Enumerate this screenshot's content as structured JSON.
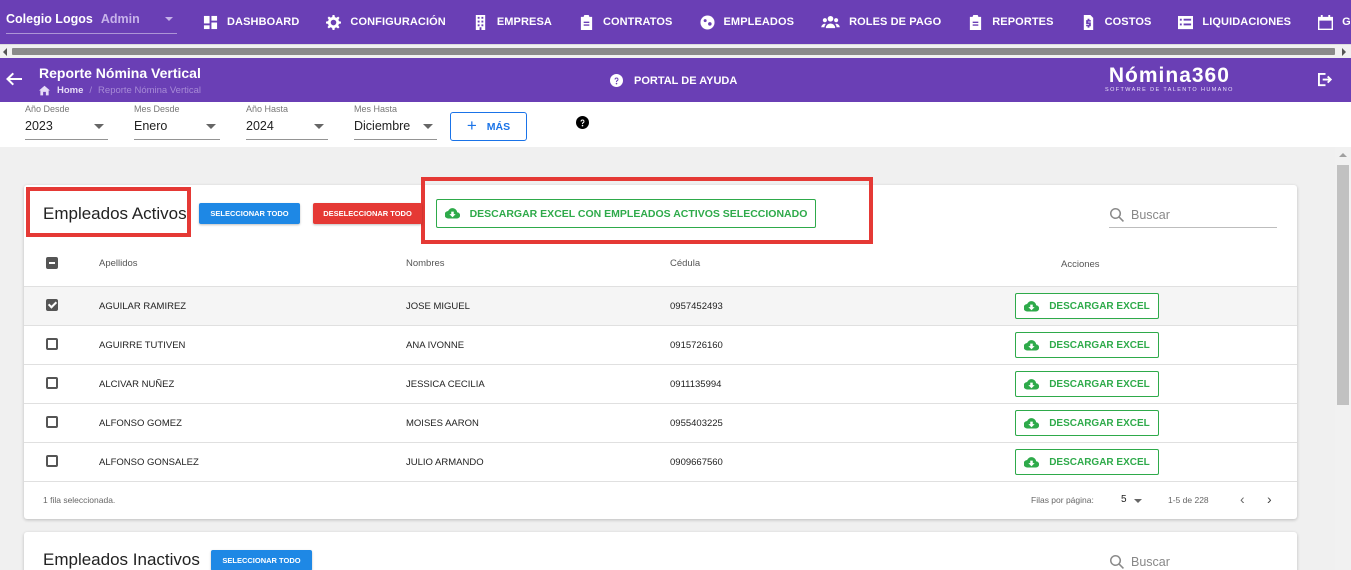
{
  "colors": {
    "nav_purple": "#6a3fb5",
    "primary_blue": "#1e88e5",
    "danger_red": "#e53935",
    "success_green": "#2eaa4a",
    "highlight_red": "#e53935"
  },
  "company": {
    "name": "Colegio Logos",
    "role": "Admin"
  },
  "nav": [
    {
      "label": "DASHBOARD",
      "icon": "dashboard-icon"
    },
    {
      "label": "CONFIGURACIÓN",
      "icon": "gear-icon"
    },
    {
      "label": "EMPRESA",
      "icon": "building-icon"
    },
    {
      "label": "CONTRATOS",
      "icon": "clipboard-icon"
    },
    {
      "label": "EMPLEADOS",
      "icon": "globe-icon"
    },
    {
      "label": "ROLES DE PAGO",
      "icon": "users-icon"
    },
    {
      "label": "REPORTES",
      "icon": "clipboard-icon"
    },
    {
      "label": "COSTOS",
      "icon": "invoice-icon"
    },
    {
      "label": "LIQUIDACIONES",
      "icon": "list-icon"
    },
    {
      "label": "GESTIÓN DE",
      "icon": "calendar-icon"
    }
  ],
  "page": {
    "title": "Reporte Nómina Vertical",
    "breadcrumb_home": "Home",
    "breadcrumb_current": "Reporte Nómina Vertical",
    "help": "PORTAL DE AYUDA",
    "brand": "Nómina360",
    "brand_tagline": "SOFTWARE DE TALENTO HUMANO"
  },
  "filters": {
    "anio_desde": {
      "label": "Año Desde",
      "value": "2023"
    },
    "mes_desde": {
      "label": "Mes Desde",
      "value": "Enero"
    },
    "anio_hasta": {
      "label": "Año Hasta",
      "value": "2024"
    },
    "mes_hasta": {
      "label": "Mes Hasta",
      "value": "Diciembre"
    },
    "mas_button": "MÁS",
    "mas_icon": "plus-icon"
  },
  "activos": {
    "title": "Empleados Activos",
    "select_all": "SELECCIONAR TODO",
    "deselect_all": "DESELECCIONAR TODO",
    "download_selected": "DESCARGAR EXCEL CON EMPLEADOS ACTIVOS SELECCIONADO",
    "search_placeholder": "Buscar",
    "columns": {
      "apellidos": "Apellidos",
      "nombres": "Nombres",
      "cedula": "Cédula",
      "acciones": "Acciones"
    },
    "row_action": "DESCARGAR EXCEL",
    "rows": [
      {
        "apellidos": "AGUILAR RAMIREZ",
        "nombres": "JOSE MIGUEL",
        "cedula": "0957452493",
        "selected": true
      },
      {
        "apellidos": "AGUIRRE TUTIVEN",
        "nombres": "ANA IVONNE",
        "cedula": "0915726160",
        "selected": false
      },
      {
        "apellidos": "ALCIVAR NUÑEZ",
        "nombres": "JESSICA CECILIA",
        "cedula": "0911135994",
        "selected": false
      },
      {
        "apellidos": "ALFONSO GOMEZ",
        "nombres": "MOISES AARON",
        "cedula": "0955403225",
        "selected": false
      },
      {
        "apellidos": "ALFONSO GONSALEZ",
        "nombres": "JULIO ARMANDO",
        "cedula": "0909667560",
        "selected": false
      }
    ],
    "selection_info": "1 fila seleccionada.",
    "rows_per_page_label": "Filas por página:",
    "rows_per_page": "5",
    "range": "1-5 de 228",
    "prev": "‹",
    "next": "›"
  },
  "inactivos": {
    "title": "Empleados Inactivos",
    "select_all": "SELECCIONAR TODO",
    "search_placeholder": "Buscar"
  }
}
